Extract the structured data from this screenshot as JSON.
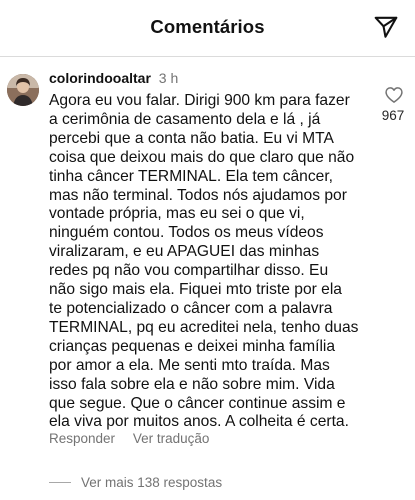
{
  "header": {
    "title": "Comentários",
    "send_icon": "paper-plane-icon"
  },
  "comment": {
    "username": "colorindooaltar",
    "time": "3 h",
    "lines": [
      "Agora eu vou falar. Dirigi 900 km para fazer",
      "a cerimônia de casamento dela e lá , já",
      "percebi que a conta não batia. Eu vi MTA",
      "coisa que deixou mais do que claro que não",
      "tinha câncer TERMINAL. Ela tem câncer,",
      "mas não terminal. Todos nós ajudamos por",
      "vontade própria, mas eu sei o que vi,",
      "ninguém contou.  Todos os meus vídeos",
      "viralizaram, e eu APAGUEI das minhas",
      "redes pq não vou compartilhar disso. Eu",
      "não sigo mais ela. Fiquei mto triste por ela",
      "te potencializado o câncer com a palavra",
      "TERMINAL, pq eu acreditei nela, tenho duas",
      "crianças pequenas e deixei minha família",
      "por amor a ela. Me senti mto traída. Mas",
      "isso fala sobre ela e não sobre mim. Vida",
      "que segue. Que o câncer continue assim e",
      "ela viva por muitos anos. A colheita é certa."
    ],
    "like_count": "967",
    "like_icon": "heart-outline-icon",
    "reply_label": "Responder",
    "translate_label": "Ver tradução",
    "view_replies_label": "Ver mais 138 respostas"
  },
  "colors": {
    "text": "#111111",
    "secondary": "#737373",
    "divider": "#dbdbdb"
  }
}
